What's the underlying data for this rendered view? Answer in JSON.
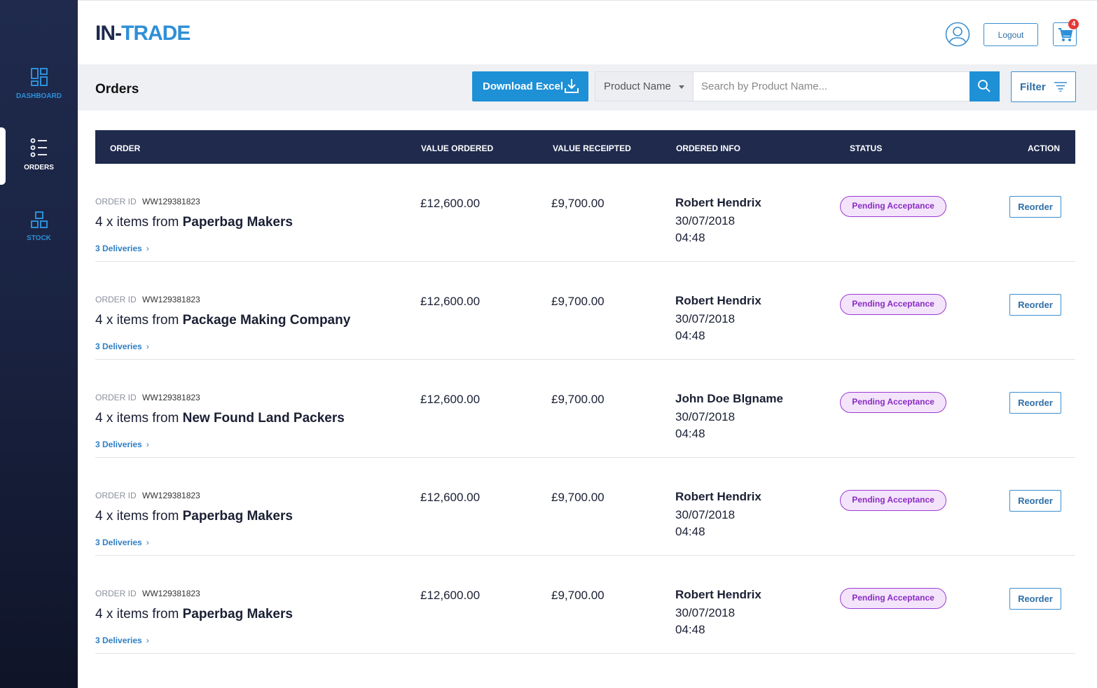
{
  "app": {
    "logo_main": "IN-",
    "logo_accent": "TRADE"
  },
  "sidebar": {
    "items": [
      {
        "label": "DASHBOARD",
        "icon": "dashboard-icon"
      },
      {
        "label": "ORDERS",
        "icon": "list-icon"
      },
      {
        "label": "STOCK",
        "icon": "stock-icon"
      }
    ]
  },
  "header": {
    "logout_label": "Logout",
    "cart_count": "4"
  },
  "toolbar": {
    "title": "Orders",
    "download_label": "Download Excel",
    "select_value": "Product Name",
    "search_placeholder": "Search by Product Name...",
    "filter_label": "Filter"
  },
  "table": {
    "columns": {
      "order": "ORDER",
      "value_ordered": "VALUE ORDERED",
      "value_receipted": "VALUE RECEIPTED",
      "ordered_info": "ORDERED INFO",
      "status": "STATUS",
      "action": "ACTION"
    },
    "order_id_label": "ORDER ID",
    "items_prefix": "4 x items from",
    "rows": [
      {
        "order_id": "WW129381823",
        "supplier": "Paperbag Makers",
        "deliveries": "3 Deliveries",
        "value_ordered": "£12,600.00",
        "value_receipted": "£9,700.00",
        "ordered_by": "Robert Hendrix",
        "date": "30/07/2018",
        "time": "04:48",
        "status": "Pending Acceptance",
        "action": "Reorder"
      },
      {
        "order_id": "WW129381823",
        "supplier": "Package Making Company",
        "deliveries": "3 Deliveries",
        "value_ordered": "£12,600.00",
        "value_receipted": "£9,700.00",
        "ordered_by": "Robert Hendrix",
        "date": "30/07/2018",
        "time": "04:48",
        "status": "Pending Acceptance",
        "action": "Reorder"
      },
      {
        "order_id": "WW129381823",
        "supplier": "New Found Land Packers",
        "deliveries": "3 Deliveries",
        "value_ordered": "£12,600.00",
        "value_receipted": "£9,700.00",
        "ordered_by": "John Doe Blgname",
        "date": "30/07/2018",
        "time": "04:48",
        "status": "Pending Acceptance",
        "action": "Reorder"
      },
      {
        "order_id": "WW129381823",
        "supplier": "Paperbag Makers",
        "deliveries": "3 Deliveries",
        "value_ordered": "£12,600.00",
        "value_receipted": "£9,700.00",
        "ordered_by": "Robert Hendrix",
        "date": "30/07/2018",
        "time": "04:48",
        "status": "Pending Acceptance",
        "action": "Reorder"
      },
      {
        "order_id": "WW129381823",
        "supplier": "Paperbag Makers",
        "deliveries": "3 Deliveries",
        "value_ordered": "£12,600.00",
        "value_receipted": "£9,700.00",
        "ordered_by": "Robert Hendrix",
        "date": "30/07/2018",
        "time": "04:48",
        "status": "Pending Acceptance",
        "action": "Reorder"
      }
    ]
  },
  "colors": {
    "sidebar": "#1f2a4d",
    "accent": "#1e90d6",
    "status": "#8a2bc2"
  }
}
